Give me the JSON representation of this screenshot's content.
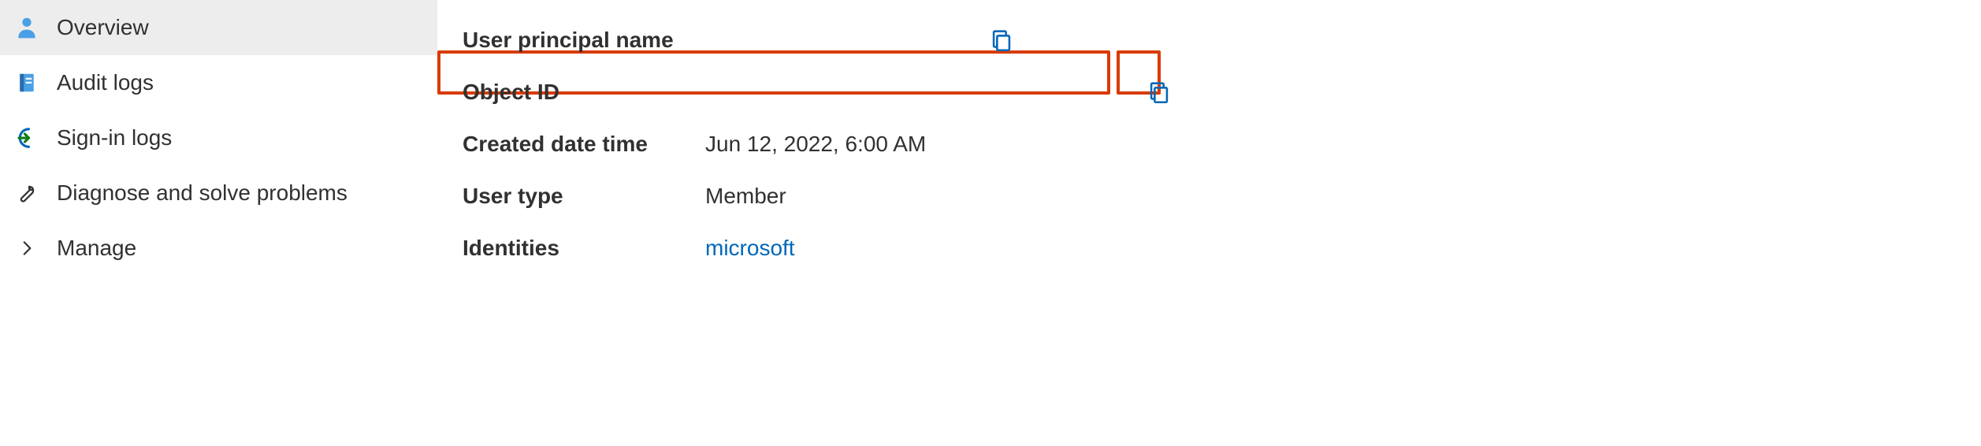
{
  "sidebar": {
    "items": [
      {
        "label": "Overview"
      },
      {
        "label": "Audit logs"
      },
      {
        "label": "Sign-in logs"
      },
      {
        "label": "Diagnose and solve problems"
      },
      {
        "label": "Manage"
      }
    ]
  },
  "fields": {
    "user_principal_name": {
      "label": "User principal name",
      "value": ""
    },
    "object_id": {
      "label": "Object ID",
      "value": ""
    },
    "created_date_time": {
      "label": "Created date time",
      "value": "Jun 12, 2022, 6:00 AM"
    },
    "user_type": {
      "label": "User type",
      "value": "Member"
    },
    "identities": {
      "label": "Identities",
      "value": "microsoft"
    }
  }
}
